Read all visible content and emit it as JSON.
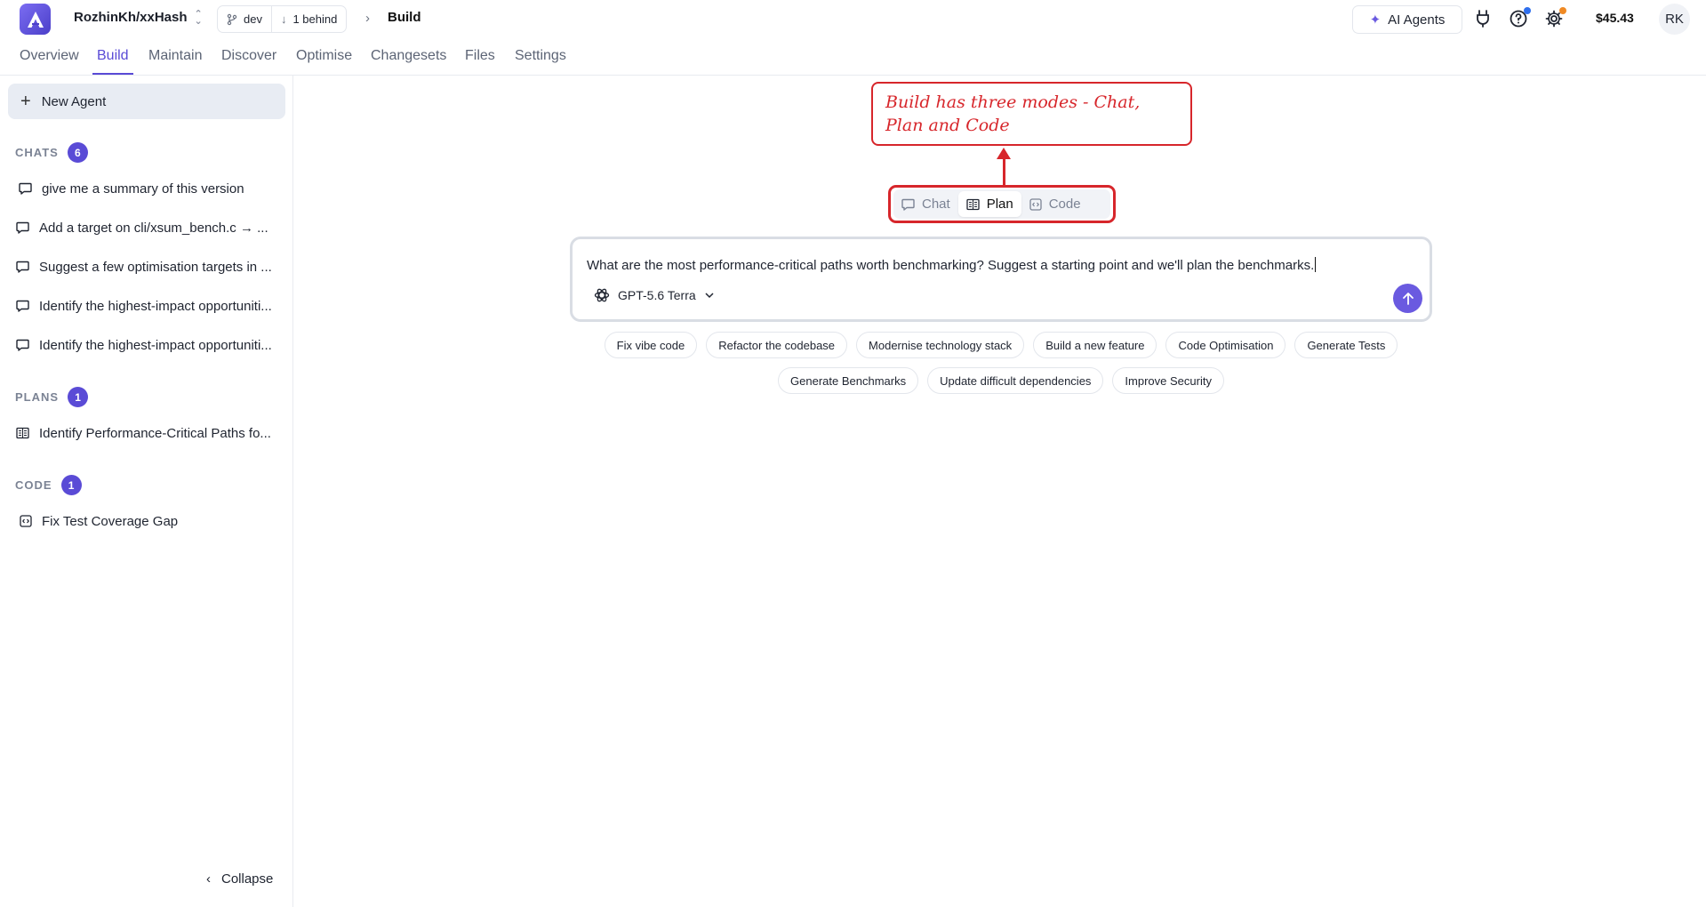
{
  "header": {
    "repo": "RozhinKh/xxHash",
    "branch": "dev",
    "behind": "1 behind",
    "breadcrumb": "Build",
    "ai_agents_label": "AI Agents",
    "balance": "$45.43",
    "avatar_initials": "RK",
    "help_dot_color": "#2f6fed",
    "settings_dot_color": "#f08a24"
  },
  "nav": {
    "tabs": [
      "Overview",
      "Build",
      "Maintain",
      "Discover",
      "Optimise",
      "Changesets",
      "Files",
      "Settings"
    ],
    "active": "Build"
  },
  "sidebar": {
    "new_agent": "New Agent",
    "chats": {
      "title": "CHATS",
      "count": "6",
      "items": [
        "give me a summary of this version",
        "Add a target on cli/xsum_bench.c → ...",
        "Suggest a few optimisation targets in ...",
        "Identify the highest-impact opportuniti...",
        "Identify the highest-impact opportuniti..."
      ]
    },
    "plans": {
      "title": "PLANS",
      "count": "1",
      "items": [
        "Identify Performance-Critical Paths fo..."
      ]
    },
    "code": {
      "title": "CODE",
      "count": "1",
      "items": [
        "Fix Test Coverage Gap"
      ]
    },
    "collapse": "Collapse"
  },
  "annotation": {
    "text": "Build has three modes - Chat, Plan and Code",
    "color": "#d7262b"
  },
  "modes": {
    "items": [
      "Chat",
      "Plan",
      "Code"
    ],
    "active": "Plan"
  },
  "composer": {
    "text": "What are the most performance-critical paths worth benchmarking? Suggest a starting point and we'll plan the benchmarks.",
    "model": "GPT-5.6 Terra",
    "accent": "#6a5ae0"
  },
  "suggestions": [
    "Fix vibe code",
    "Refactor the codebase",
    "Modernise technology stack",
    "Build a new feature",
    "Code Optimisation",
    "Generate Tests",
    "Generate Benchmarks",
    "Update difficult dependencies",
    "Improve Security"
  ]
}
